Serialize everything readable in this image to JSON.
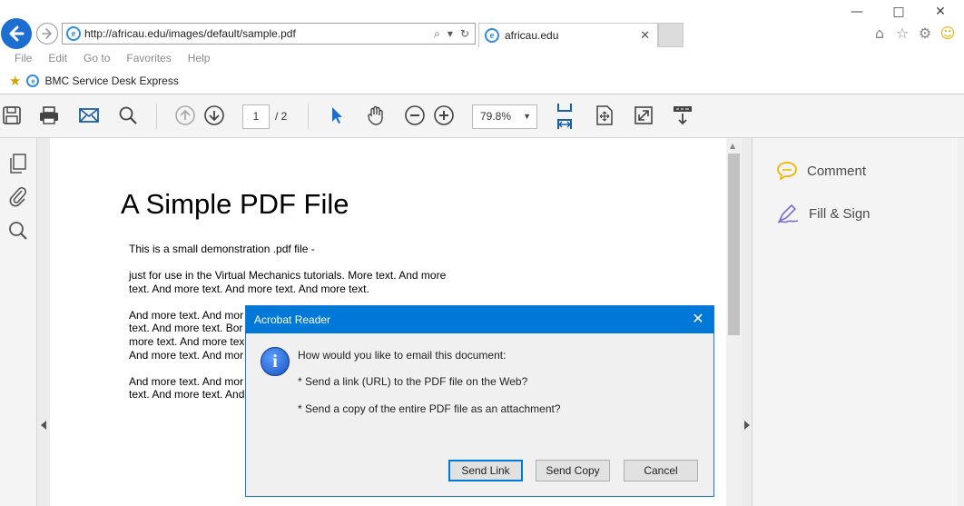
{
  "browser": {
    "url": "http://africau.edu/images/default/sample.pdf",
    "tab_title": "africau.edu",
    "menu": [
      "File",
      "Edit",
      "Go to",
      "Favorites",
      "Help"
    ],
    "favorite": "BMC Service Desk Express"
  },
  "toolbar": {
    "current_page": "1",
    "total_pages": "/ 2",
    "zoom": "79.8%"
  },
  "right_panel": {
    "comment": "Comment",
    "fill_sign": "Fill & Sign"
  },
  "pdf": {
    "title": "A Simple PDF File",
    "lines": [
      "This is a small demonstration .pdf file -",
      "just for use in the Virtual Mechanics tutorials. More text. And more",
      "text. And more text. And more text. And more text.",
      "And more text. And mor",
      "text. And more text. Bor",
      "more text. And more tex",
      "And more text. And mor",
      "And more text. And mor",
      "text. And more text. And"
    ]
  },
  "dialog": {
    "title": "Acrobat Reader",
    "question": "How would you like to email this document:",
    "option_link": "* Send a link (URL) to the PDF file on the Web?",
    "option_copy": "* Send a copy of the entire PDF file as an attachment?",
    "send_link": "Send Link",
    "send_copy": "Send Copy",
    "cancel": "Cancel"
  },
  "colors": {
    "accent": "#0078d7",
    "cursor_tool": "#1a6fd0",
    "comment_icon": "#f2b600",
    "fill_sign_icon": "#7b6bd6"
  }
}
